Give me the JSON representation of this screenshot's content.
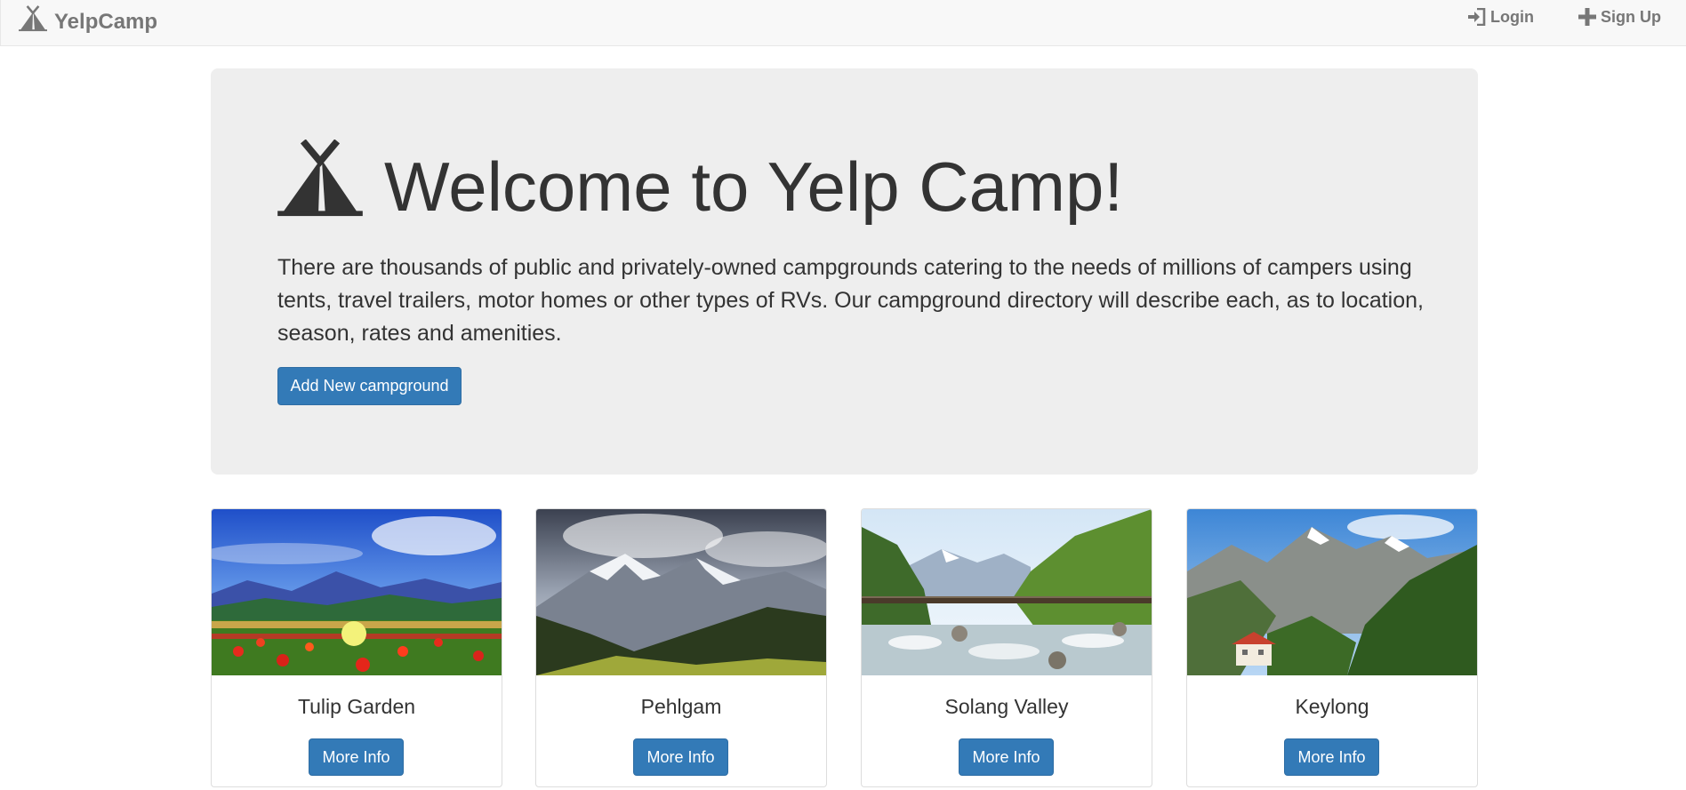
{
  "navbar": {
    "brand": "YelpCamp",
    "brand_icon": "tent-icon",
    "login_label": "Login",
    "login_icon": "log-in-icon",
    "signup_label": "Sign Up",
    "signup_icon": "plus-icon",
    "link_color": "#777777"
  },
  "hero": {
    "icon": "tent-icon",
    "title": "Welcome to Yelp Camp!",
    "description": "There are thousands of public and privately-owned campgrounds catering to the needs of millions of campers using tents, travel trailers, motor homes or other types of RVs. Our campground directory will describe each, as to location, season, rates and amenities.",
    "add_button_label": "Add New campground"
  },
  "campgrounds": [
    {
      "name": "Tulip Garden",
      "button_label": "More Info"
    },
    {
      "name": "Pehlgam",
      "button_label": "More Info"
    },
    {
      "name": "Solang Valley",
      "button_label": "More Info"
    },
    {
      "name": "Keylong",
      "button_label": "More Info"
    }
  ],
  "colors": {
    "primary": "#337ab7",
    "jumbotron_bg": "#eeeeee",
    "navbar_bg": "#f8f8f8"
  }
}
